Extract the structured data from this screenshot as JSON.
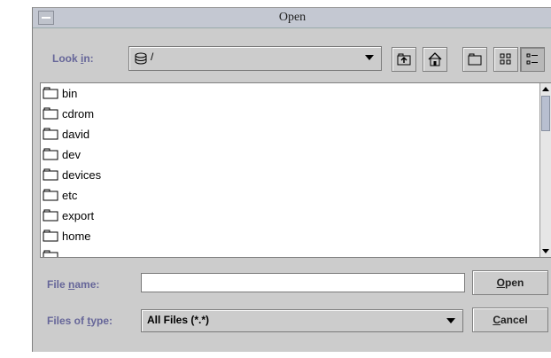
{
  "window": {
    "title": "Open"
  },
  "look_in": {
    "label_prefix": "Look ",
    "label_mnemonic": "i",
    "label_suffix": "n:",
    "value": "/",
    "icon": "drive-icon"
  },
  "toolbar": {
    "buttons": [
      "up-folder-icon",
      "home-icon",
      "new-folder-icon",
      "list-view-icon",
      "details-view-icon"
    ]
  },
  "files": [
    {
      "name": "bin"
    },
    {
      "name": "cdrom"
    },
    {
      "name": "david"
    },
    {
      "name": "dev"
    },
    {
      "name": "devices"
    },
    {
      "name": "etc"
    },
    {
      "name": "export"
    },
    {
      "name": "home"
    }
  ],
  "file_name": {
    "label_prefix": "File ",
    "label_mnemonic": "n",
    "label_suffix": "ame:",
    "value": ""
  },
  "file_type": {
    "label_prefix": "Files of ",
    "label_mnemonic": "t",
    "label_suffix": "ype:",
    "value": "All Files (*.*)"
  },
  "buttons": {
    "open_mnemonic": "O",
    "open_rest": "pen",
    "cancel_mnemonic": "C",
    "cancel_rest": "ancel"
  }
}
